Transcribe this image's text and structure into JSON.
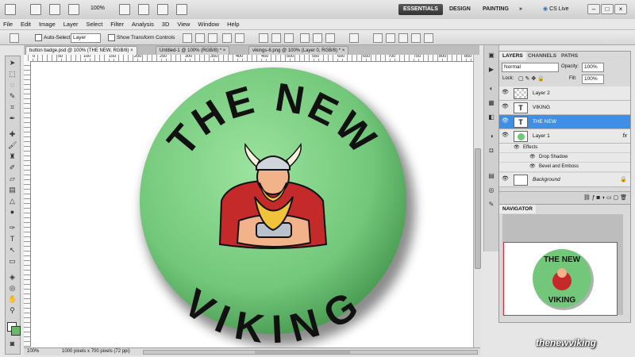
{
  "appbar": {
    "zoom": "100%",
    "workspaces": [
      "ESSENTIALS",
      "DESIGN",
      "PAINTING"
    ],
    "more": "»",
    "cs_live": "CS Live"
  },
  "menu": [
    "File",
    "Edit",
    "Image",
    "Layer",
    "Select",
    "Filter",
    "Analysis",
    "3D",
    "View",
    "Window",
    "Help"
  ],
  "options": {
    "auto_select_label": "Auto-Select:",
    "auto_select_value": "Layer",
    "show_transform": "Show Transform Controls"
  },
  "tabs": [
    "button badge.psd @ 100% (THE NEW, RGB/8)",
    "Untitled-1 @ 100% (RGB/8) *",
    "vikings-6.png @ 100% (Layer 0, RGB/8) *"
  ],
  "ruler": [
    "0",
    "50",
    "100",
    "150",
    "200",
    "250",
    "300",
    "350",
    "400",
    "450",
    "500",
    "550",
    "600",
    "650",
    "700",
    "750",
    "800",
    "850"
  ],
  "badge": {
    "top_text": "THE NEW",
    "bottom_text": "VIKING"
  },
  "status": {
    "zoom": "100%",
    "size": "1000 pixels x 700 pixels (72 ppi)"
  },
  "layers_panel": {
    "tabs": [
      "LAYERS",
      "CHANNELS",
      "PATHS"
    ],
    "blend_mode": "Normal",
    "opacity_label": "Opacity:",
    "opacity": "100%",
    "lock_label": "Lock:",
    "fill_label": "Fill:",
    "fill": "100%",
    "layers": [
      "Layer 2",
      "VIKING",
      "THE NEW",
      "Layer 1"
    ],
    "effects_label": "Effects",
    "effects": [
      "Drop Shadow",
      "Bevel and Emboss"
    ],
    "background": "Background",
    "fx": "fx"
  },
  "navigator": {
    "title": "NAVIGATOR"
  },
  "watermark": "thenewviking",
  "colors": {
    "accent": "#3f8fe6",
    "badge_green": "#72c77a",
    "nav_frame": "#dd3333"
  }
}
